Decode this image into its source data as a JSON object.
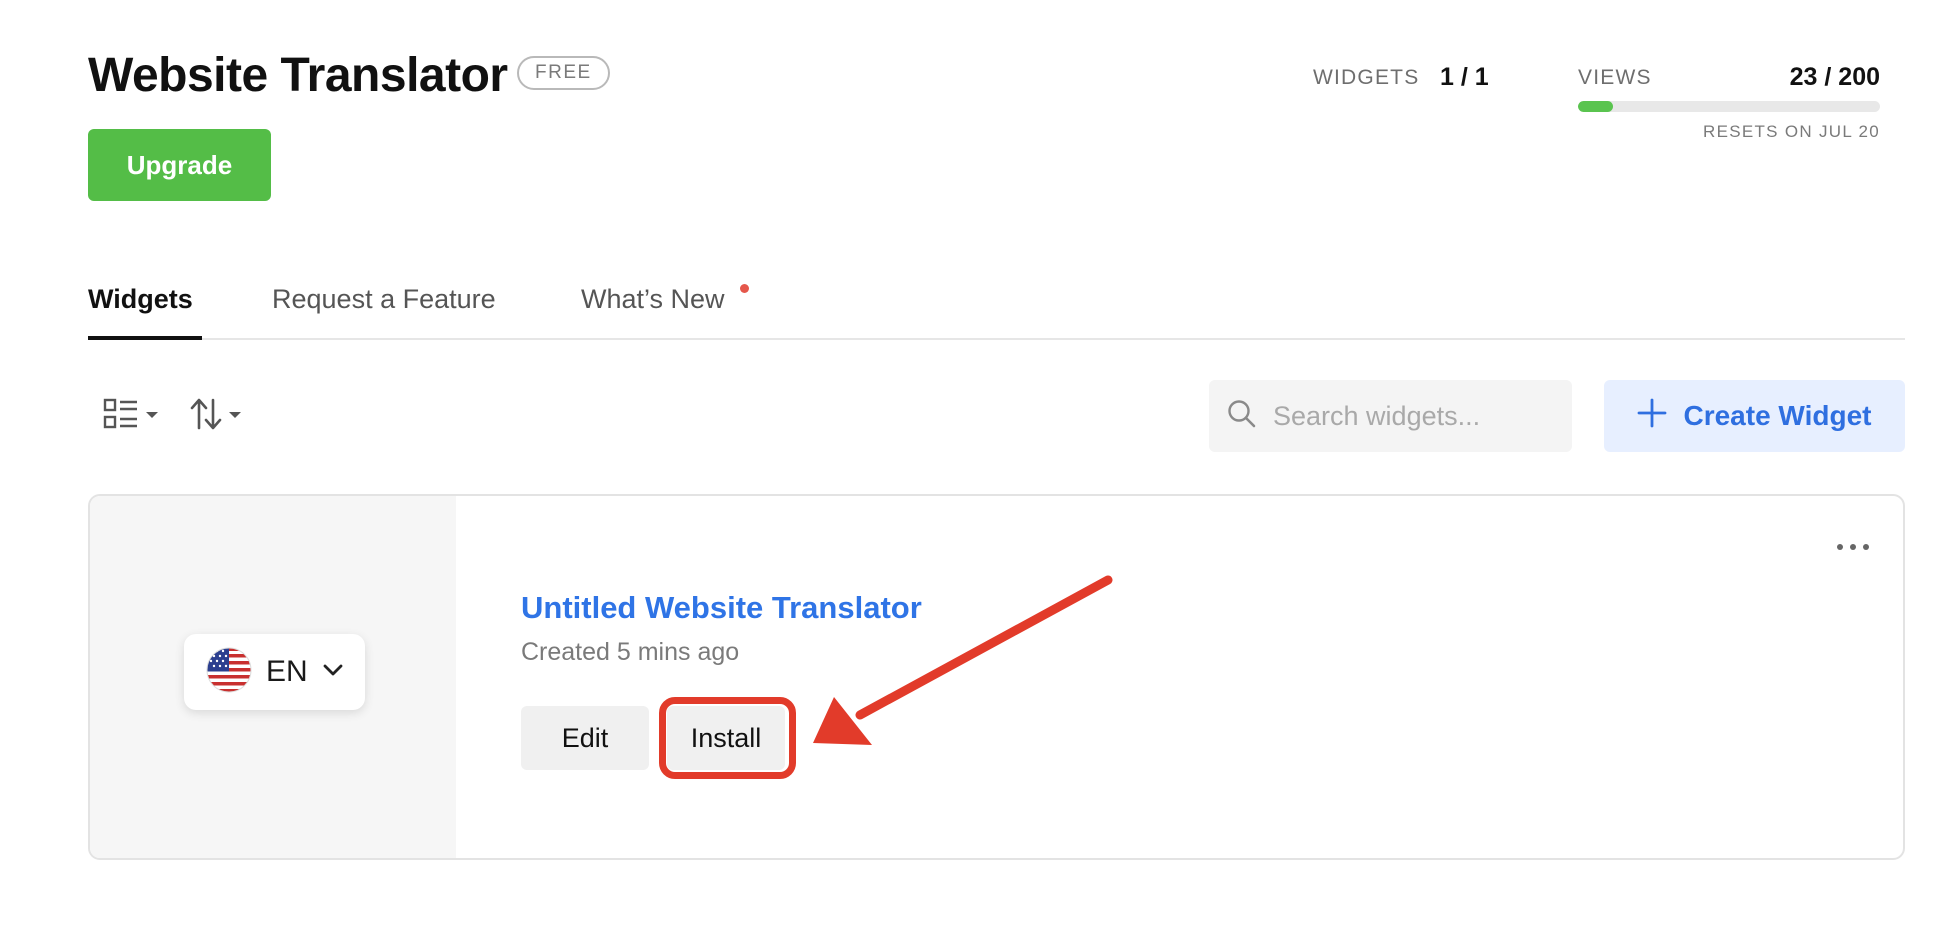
{
  "header": {
    "title": "Website Translator",
    "plan_badge": "FREE",
    "upgrade_label": "Upgrade"
  },
  "stats": {
    "widgets_label": "WIDGETS",
    "widgets_value": "1 / 1",
    "views_label": "VIEWS",
    "views_value": "23 / 200",
    "views_used_fraction": 0.115,
    "resets_text": "RESETS ON JUL 20"
  },
  "tabs": [
    {
      "label": "Widgets",
      "active": true
    },
    {
      "label": "Request a Feature",
      "active": false
    },
    {
      "label": "What’s New",
      "active": false,
      "has_notification": true
    }
  ],
  "toolbar": {
    "view_toggle_icon": "grid-list-icon",
    "sort_icon": "sort-arrows-icon",
    "search_placeholder": "Search widgets...",
    "create_label": "Create Widget"
  },
  "widgets": [
    {
      "name": "Untitled Website Translator",
      "meta": "Created 5 mins ago",
      "language": "EN",
      "flag": "us-flag-icon",
      "edit_label": "Edit",
      "install_label": "Install"
    }
  ],
  "colors": {
    "accent_green": "#54bd47",
    "link_blue": "#2f74e6",
    "annotation_red": "#e23b2a"
  }
}
